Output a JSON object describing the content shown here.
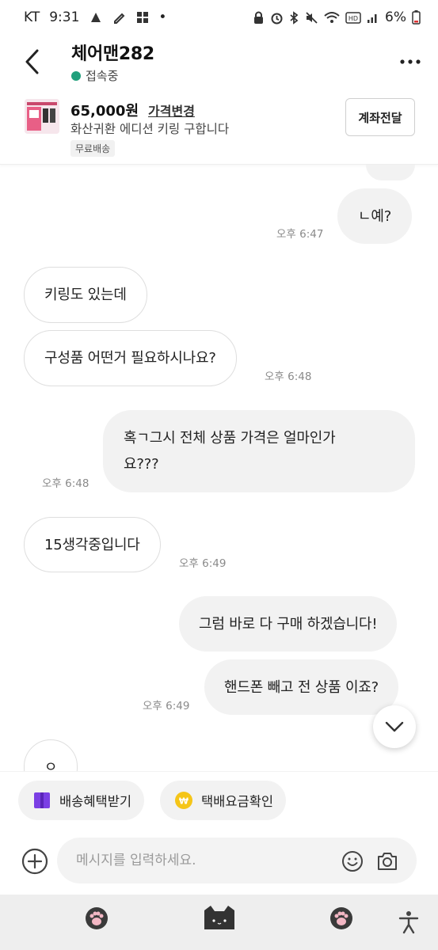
{
  "status_bar": {
    "carrier": "KT",
    "time": "9:31",
    "battery": "6%",
    "dot": "•"
  },
  "header": {
    "partner_name": "체어맨282",
    "online_status": "접속중",
    "online_color": "#21a07c"
  },
  "product": {
    "price": "65,000원",
    "price_change_label": "가격변경",
    "title": "화산귀환 에디션 키링 구합니다",
    "shipping_badge": "무료배송",
    "pay_button_label": "계좌전달"
  },
  "messages": [
    {
      "id": "m0",
      "side": "out",
      "text": "",
      "time": ""
    },
    {
      "id": "m1",
      "side": "out",
      "text": "ㄴ예?",
      "time": "오후 6:47"
    },
    {
      "id": "m2",
      "side": "in",
      "text": "키링도 있는데",
      "time": ""
    },
    {
      "id": "m3",
      "side": "in",
      "text": "구성품 어떤거 필요하시나요?",
      "time": "오후 6:48"
    },
    {
      "id": "m4",
      "side": "out",
      "text_line1": "혹ㄱ그시 전체 상품 가격은 얼마인가",
      "text_line2": "요???",
      "time": "오후 6:48"
    },
    {
      "id": "m5",
      "side": "in",
      "text": "15생각중입니다",
      "time": "오후 6:49"
    },
    {
      "id": "m6",
      "side": "out",
      "text": "그럼 바로 다 구매 하겠습니다!",
      "time": ""
    },
    {
      "id": "m7",
      "side": "out",
      "text": "핸드폰 빼고 전 상품 이죠?",
      "time": "오후 6:49"
    },
    {
      "id": "m8",
      "side": "in",
      "text": "ㅇ",
      "time": ""
    }
  ],
  "quick_actions": [
    {
      "label": "배송혜택받기",
      "icon": "gift-box-icon",
      "color": "#7b3fe4"
    },
    {
      "label": "택배요금확인",
      "icon": "won-coin-icon",
      "color": "#f5c518"
    }
  ],
  "composer": {
    "placeholder": "메시지를 입력하세요.",
    "value": ""
  },
  "nav": {
    "left_icon": "paw-icon",
    "center_icon": "cat-face-icon",
    "right_icon": "paw-icon",
    "accessibility_icon": "accessibility-icon"
  }
}
